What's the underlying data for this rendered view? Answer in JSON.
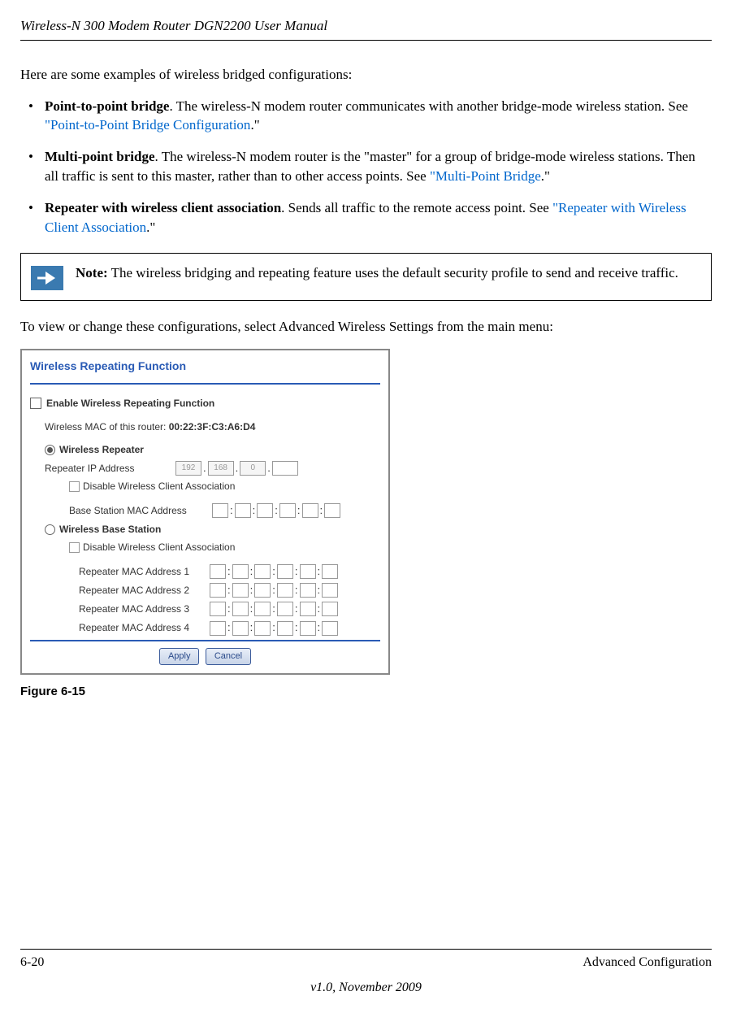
{
  "header": {
    "title": "Wireless-N 300 Modem Router DGN2200 User Manual"
  },
  "intro": "Here are some examples of wireless bridged configurations:",
  "bullets": [
    {
      "bold": "Point-to-point bridge",
      "text1": ". The wireless-N modem router communicates with another bridge-mode wireless station. See ",
      "link": "\"Point-to-Point Bridge Configuration",
      "text2": ".\""
    },
    {
      "bold": "Multi-point bridge",
      "text1": ". The wireless-N modem router is the \"master\" for a group of bridge-mode wireless stations. Then all traffic is sent to this master, rather than to other access points. See ",
      "link": "\"Multi-Point Bridge",
      "text2": ".\""
    },
    {
      "bold": "Repeater with wireless client association",
      "text1": ". Sends all traffic to the remote access point. See ",
      "link": "\"Repeater with Wireless Client Association",
      "text2": ".\""
    }
  ],
  "note": {
    "bold": "Note:",
    "text": " The wireless bridging and repeating feature uses the default security profile to send and receive traffic."
  },
  "after_note": "To view or change these configurations, select Advanced Wireless Settings from the main menu:",
  "screenshot": {
    "title": "Wireless Repeating Function",
    "enable_label": "Enable Wireless Repeating Function",
    "mac_label": "Wireless MAC of this router: ",
    "mac_value": "00:22:3F:C3:A6:D4",
    "repeater_label": "Wireless Repeater",
    "repeater_ip_label": "Repeater IP Address",
    "ip": [
      "192",
      "168",
      "0",
      ""
    ],
    "disable_client_label": "Disable Wireless Client Association",
    "base_mac_label": "Base Station MAC Address",
    "base_station_label": "Wireless Base Station",
    "repeater_mac_labels": [
      "Repeater MAC Address 1",
      "Repeater MAC Address 2",
      "Repeater MAC Address 3",
      "Repeater MAC Address 4"
    ],
    "apply_button": "Apply",
    "cancel_button": "Cancel"
  },
  "figure_caption": "Figure 6-15",
  "footer": {
    "page": "6-20",
    "section": "Advanced Configuration",
    "version": "v1.0, November 2009"
  }
}
